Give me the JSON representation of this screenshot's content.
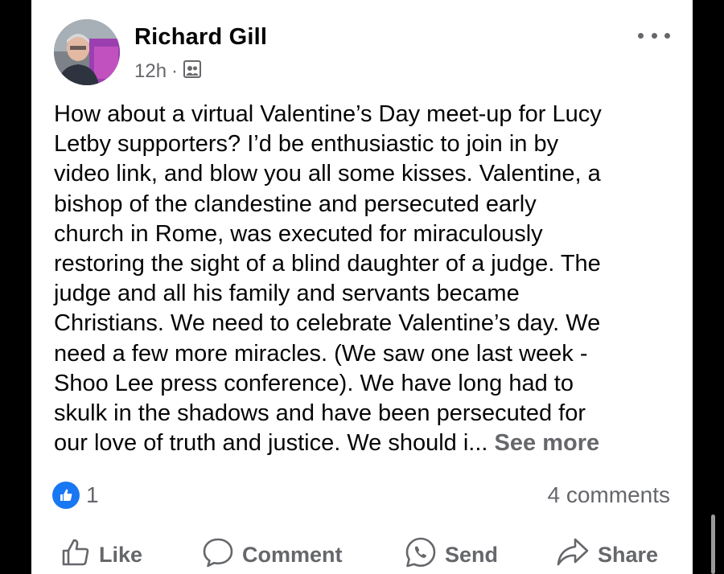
{
  "post": {
    "author": "Richard Gill",
    "time": "12h",
    "separator": "·",
    "audience_icon": "public-icon",
    "text": "How about a virtual Valentine’s Day meet-up for Lucy\nLetby supporters? I’d be enthusiastic to join in by\nvideo link, and blow you all some kisses. Valentine, a\nbishop of the clandestine and persecuted early\nchurch in Rome, was executed for miraculously\nrestoring the sight of a blind daughter of a judge. The\njudge and all his family and servants became\nChristians. We need to celebrate Valentine’s day. We\nneed a few more miracles. (We saw one last week -\nShoo Lee press conference). We have long had to\nskulk in the shadows and have been persecuted for\nour love of truth and justice. We should i... ",
    "see_more": "See more",
    "reaction_count": "1",
    "comments": "4 comments"
  },
  "actions": {
    "like": "Like",
    "comment": "Comment",
    "send": "Send",
    "share": "Share"
  },
  "colors": {
    "accent": "#1877f2",
    "muted": "#65676b",
    "text": "#050505"
  }
}
